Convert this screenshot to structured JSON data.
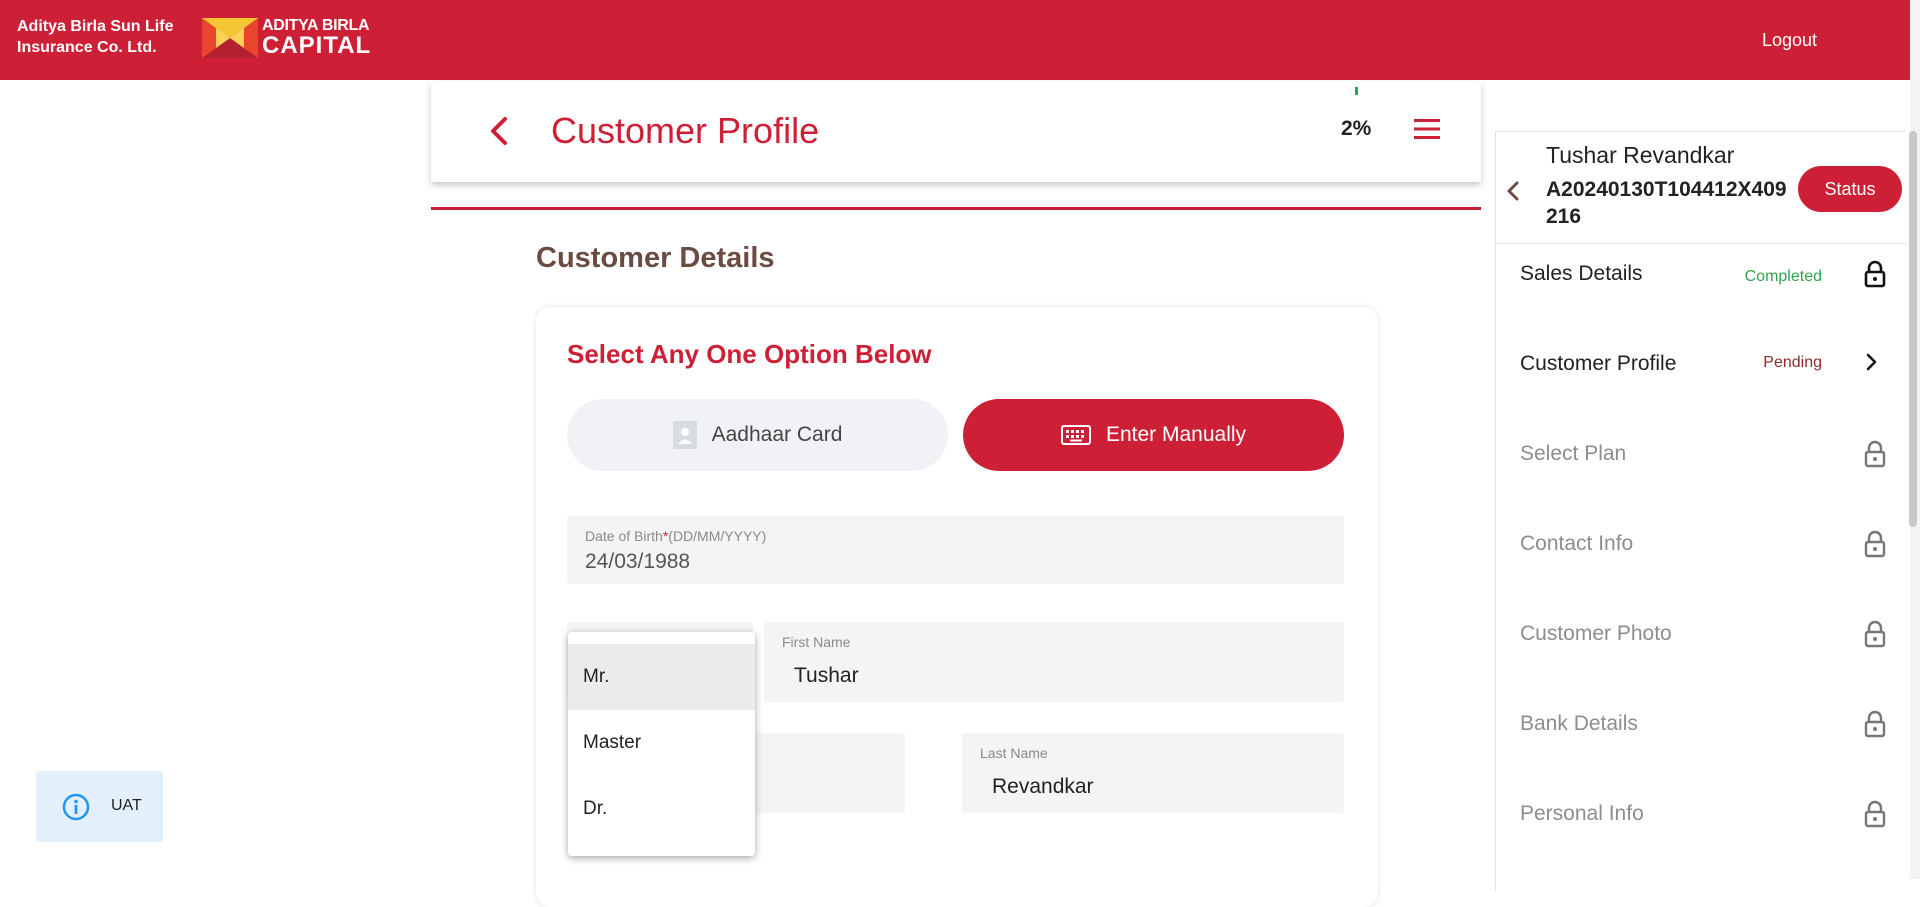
{
  "header": {
    "brand_line1": "Aditya Birla Sun Life",
    "brand_line2": "Insurance Co. Ltd.",
    "logo_line1": "ADITYA BIRLA",
    "logo_line2": "CAPITAL",
    "logout_label": "Logout",
    "accent_color": "#cd1f36"
  },
  "page": {
    "title": "Customer Profile",
    "progress": "2%",
    "section_title": "Customer Details"
  },
  "options": {
    "title": "Select Any One Option Below",
    "aadhaar_label": "Aadhaar Card",
    "manual_label": "Enter Manually",
    "selected": "Enter Manually"
  },
  "form": {
    "dob_label": "Date of Birth",
    "dob_required": "*",
    "dob_format": "(DD/MM/YYYY)",
    "dob_value": "24/03/1988",
    "first_name_label": "First Name",
    "first_name_value": "Tushar",
    "last_name_label": "Last Name",
    "last_name_value": "Revandkar"
  },
  "title_dropdown": {
    "options": [
      "Mr.",
      "Master",
      "Dr."
    ],
    "highlighted": "Mr."
  },
  "env_badge": {
    "label": "UAT"
  },
  "sidebar": {
    "customer_name": "Tushar Revandkar",
    "application_id": "A20240130T104412X409216",
    "status_button": "Status",
    "steps": [
      {
        "name": "Sales Details",
        "status": "Completed",
        "icon": "lock-icon"
      },
      {
        "name": "Customer Profile",
        "status": "Pending",
        "icon": "chevron-right-icon"
      },
      {
        "name": "Select Plan",
        "status": "",
        "icon": "lock-icon"
      },
      {
        "name": "Contact Info",
        "status": "",
        "icon": "lock-icon"
      },
      {
        "name": "Customer Photo",
        "status": "",
        "icon": "lock-icon"
      },
      {
        "name": "Bank Details",
        "status": "",
        "icon": "lock-icon"
      },
      {
        "name": "Personal Info",
        "status": "",
        "icon": "lock-icon"
      }
    ]
  }
}
